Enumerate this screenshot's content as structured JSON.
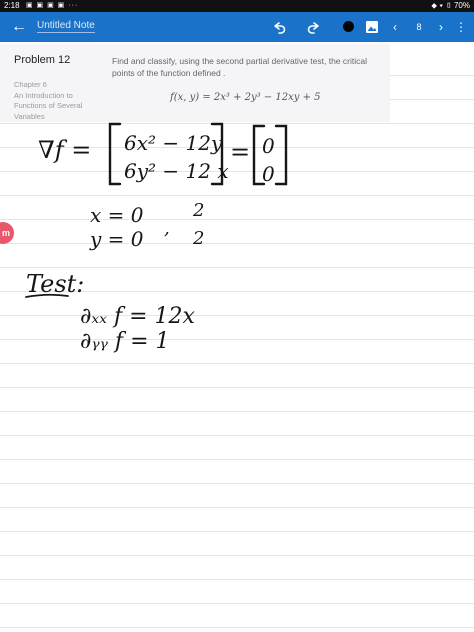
{
  "status_bar": {
    "time": "2:18",
    "icons": "▣ ▣ ▣ ▣ ···",
    "right": "⬥ ▾ ▯ 70%"
  },
  "app_bar": {
    "title": "Untitled Note",
    "page_number": "8",
    "icons": {
      "back": "arrow-left-icon",
      "undo": "undo-icon",
      "redo": "redo-icon",
      "pen": "pen-color-icon",
      "image": "insert-image-icon",
      "prev": "chevron-left-icon",
      "next": "chevron-right-icon",
      "more": "more-vert-icon"
    }
  },
  "problem": {
    "title": "Problem 12",
    "chapter_lines": [
      "Chapter 6",
      "An Introduction to",
      "Functions of Several",
      "Variables"
    ],
    "question": "Find and classify, using the second partial derivative test, the critical points of the function defined .",
    "formula": "f(x, y) = 2x³ + 2y³ − 12xy + 5"
  },
  "side_button": "m",
  "handwriting": {
    "grad_lhs": "∇f =",
    "row1": "6x² − 12y",
    "row2": "6y² − 12 x",
    "eq": "=",
    "zero1": "0",
    "zero2": "0",
    "x0": "x = 0",
    "y0": "y = 0",
    "comma": ",",
    "two1": "2",
    "two2": "2",
    "test": "Test:",
    "fxx": "∂ₓₓ f = 12x",
    "fyy": "∂ᵧᵧ f = 1"
  },
  "colors": {
    "app_bar": "#1a73c8",
    "status_bar": "#111111",
    "card": "#f5f5f7",
    "ink": "#161616",
    "side_button": "#e8576a"
  }
}
